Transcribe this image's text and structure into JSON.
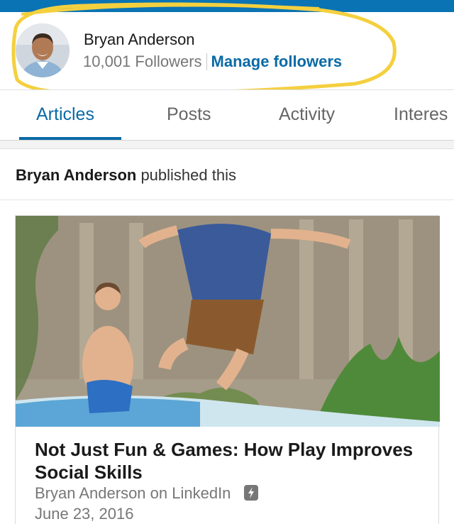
{
  "profile": {
    "name": "Bryan Anderson",
    "followers": "10,001 Followers",
    "manage_link": "Manage followers"
  },
  "tabs": [
    {
      "label": "Articles",
      "active": true
    },
    {
      "label": "Posts",
      "active": false
    },
    {
      "label": "Activity",
      "active": false
    },
    {
      "label": "Interes",
      "active": false
    }
  ],
  "feed": {
    "author": "Bryan Anderson",
    "action": " published this",
    "article": {
      "title": "Not Just Fun & Games: How Play Improves Social Skills",
      "byline": "Bryan Anderson on LinkedIn",
      "date": "June 23, 2016",
      "icon": "lightning-bolt-icon"
    }
  },
  "colors": {
    "brand_blue": "#0a73b4",
    "link_blue": "#0a6aa6",
    "highlight_yellow": "#f4d03f"
  }
}
